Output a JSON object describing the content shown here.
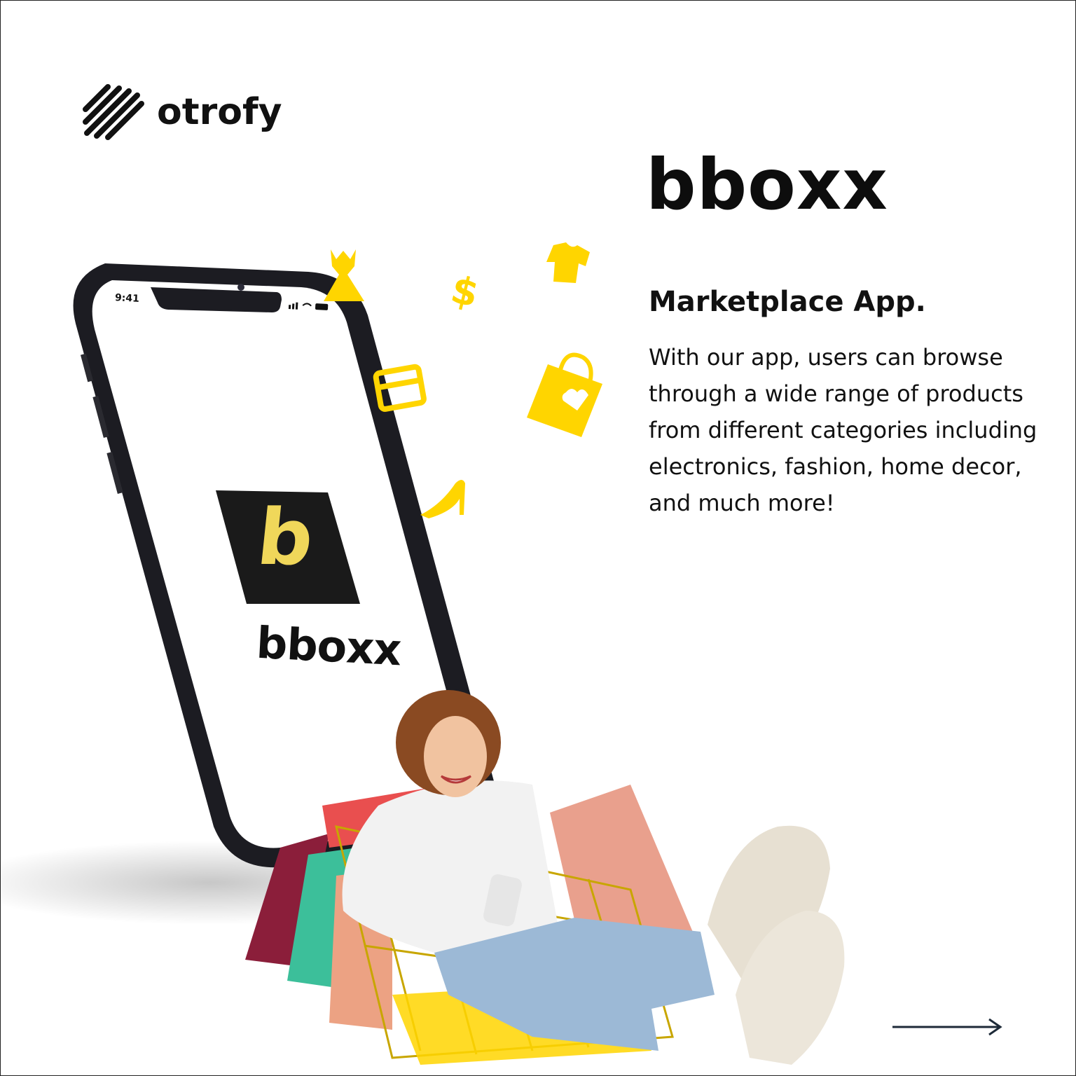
{
  "brand": {
    "name": "otrofy",
    "icon": "diagonal-stripes-logo-icon"
  },
  "app": {
    "name": "bboxx",
    "logo_letter": "b",
    "logo_wordmark": "bboxx"
  },
  "headline": "Marketplace App.",
  "description": "With our app, users can browse through a wide range of products from different categories including electronics, fashion, home decor, and much more!",
  "phone": {
    "time": "9:41"
  },
  "floating_icons": [
    "dress-icon",
    "dollar-icon",
    "tshirt-icon",
    "credit-card-icon",
    "shopping-bag-heart-icon",
    "high-heel-icon"
  ],
  "navigation": {
    "next": "arrow-right-icon"
  },
  "colors": {
    "accent": "#FFD500",
    "dark": "#111111",
    "phone_frame": "#1c1c22",
    "logo_bg": "#1a1a1a",
    "logo_letter": "#f0d75a"
  }
}
